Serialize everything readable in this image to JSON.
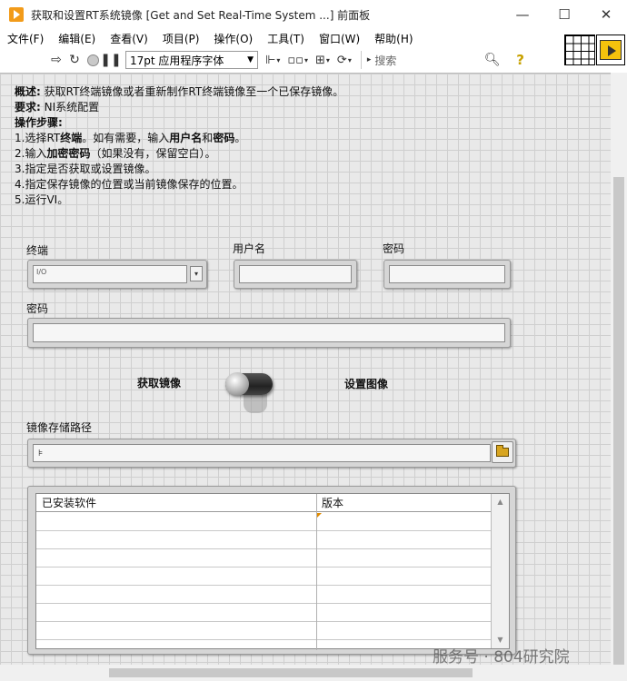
{
  "window": {
    "title": "获取和设置RT系统镜像 [Get and Set Real-Time System ...] 前面板",
    "controls": {
      "minimize": "—",
      "maximize": "☐",
      "close": "✕"
    }
  },
  "menu": [
    "文件(F)",
    "编辑(E)",
    "查看(V)",
    "项目(P)",
    "操作(O)",
    "工具(T)",
    "窗口(W)",
    "帮助(H)"
  ],
  "toolbar": {
    "font": "17pt 应用程序字体",
    "search_placeholder": "搜索",
    "help": "?"
  },
  "description": {
    "overview_label": "概述:",
    "overview_text": " 获取RT终端镜像或者重新制作RT终端镜像至一个已保存镜像。",
    "requires_label": "要求:",
    "requires_text": "  NI系统配置",
    "steps_label": "操作步骤:",
    "step1_a": "1.选择RT",
    "step1_b": "终端",
    "step1_c": "。如有需要，输入",
    "step1_d": "用户名",
    "step1_e": "和",
    "step1_f": "密码",
    "step1_g": "。",
    "step2_a": "2.输入",
    "step2_b": "加密密码",
    "step2_c": "（如果没有，保留空白）。",
    "step3": "3.指定是否获取或设置镜像。",
    "step4": "4.指定保存镜像的位置或当前镜像保存的位置。",
    "step5": "5.运行VI。"
  },
  "controls": {
    "terminal_label": "终端",
    "terminal_io": "I/O",
    "username_label": "用户名",
    "password_label": "密码",
    "encrypt_password_label": "密码",
    "get_image_label": "获取镜像",
    "set_image_label": "设置图像",
    "image_path_label": "镜像存储路径"
  },
  "table": {
    "columns": [
      "已安装软件",
      "版本"
    ],
    "rows": 7
  },
  "watermark": "服务号 · 804研究院"
}
